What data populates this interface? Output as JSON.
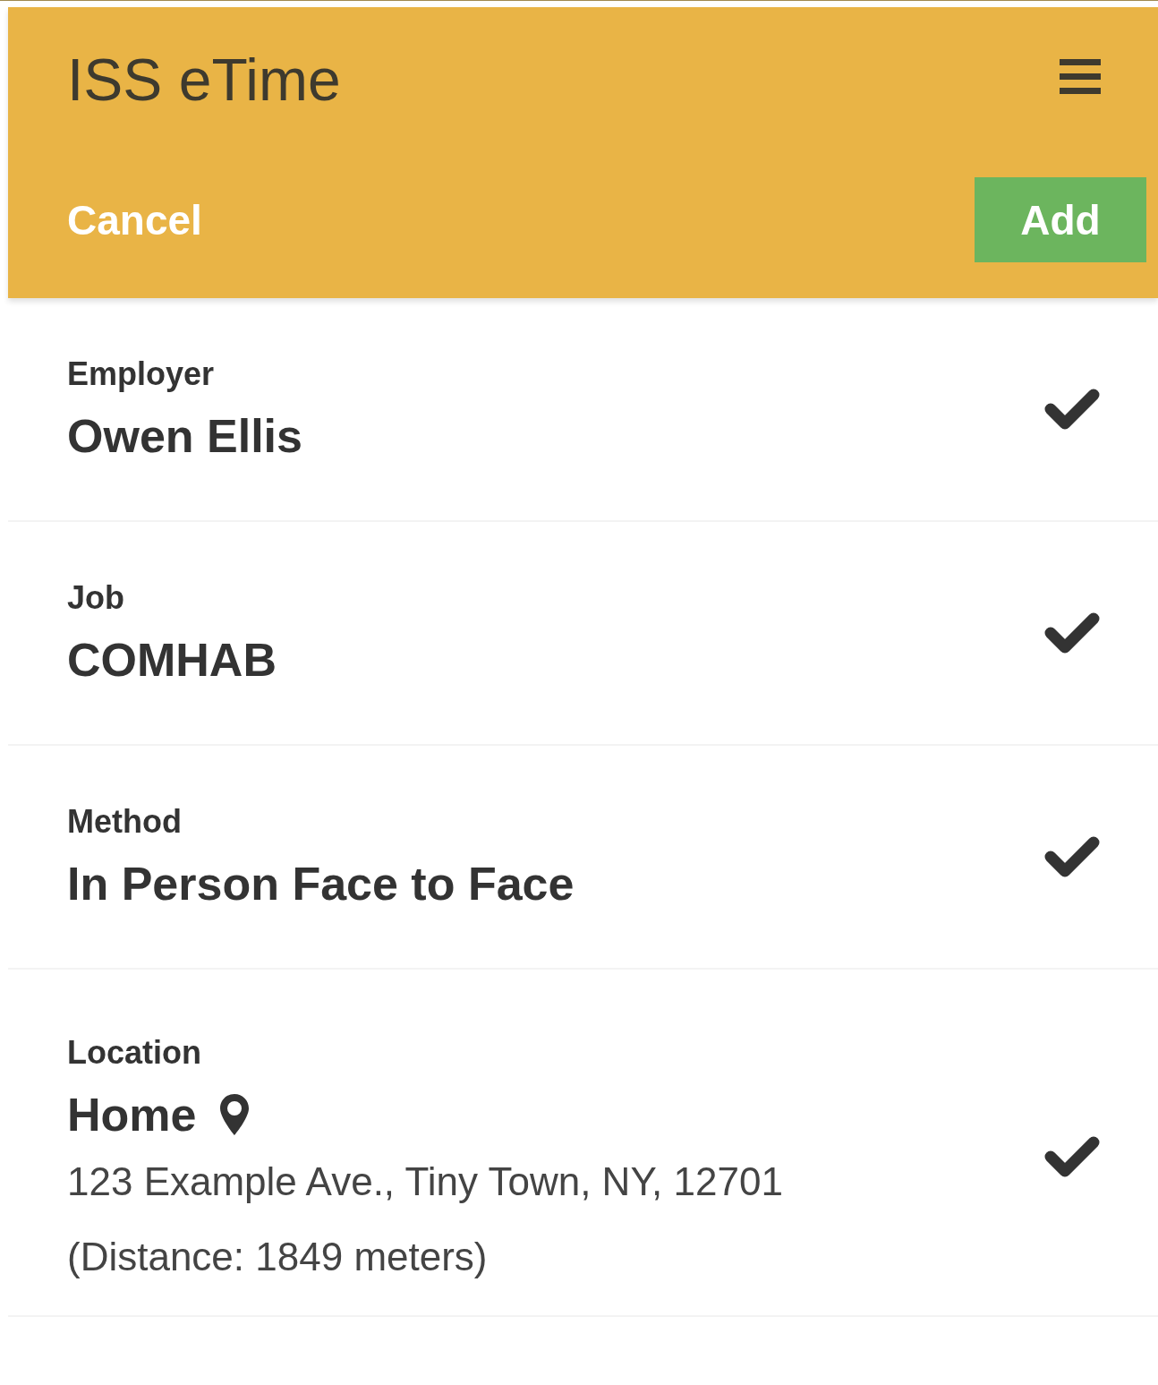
{
  "app_bar": {
    "title": "ISS eTime",
    "cancel": "Cancel",
    "add": "Add"
  },
  "fields": [
    {
      "label": "Employer",
      "value": "Owen Ellis",
      "checked": true
    },
    {
      "label": "Job",
      "value": "COMHAB",
      "checked": true
    },
    {
      "label": "Method",
      "value": "In Person Face to Face",
      "checked": true
    },
    {
      "label": "Location",
      "value": "Home",
      "kind": "location",
      "checked": true,
      "details": [
        "123 Example Ave., Tiny Town, NY, 12701",
        "(Distance: 1849 meters)"
      ]
    }
  ]
}
